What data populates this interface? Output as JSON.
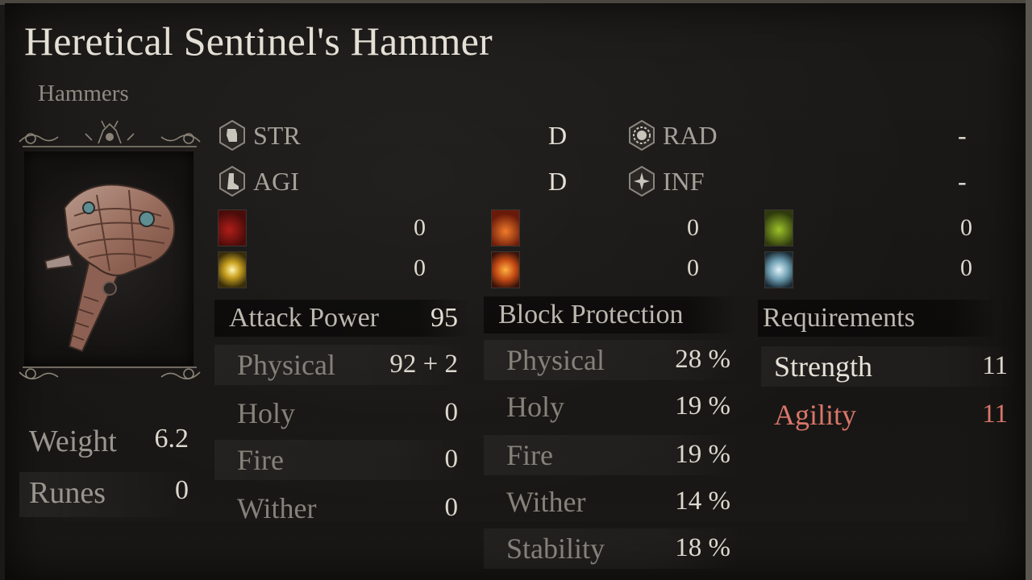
{
  "item": {
    "name": "Heretical Sentinel's Hammer",
    "category": "Hammers"
  },
  "weight": {
    "label": "Weight",
    "value": "6.2"
  },
  "runes": {
    "label": "Runes",
    "value": "0"
  },
  "scaling": [
    {
      "label": "STR",
      "grade": "D",
      "icon": "fist-icon"
    },
    {
      "label": "AGI",
      "grade": "D",
      "icon": "boot-icon"
    },
    {
      "label": "RAD",
      "grade": "-",
      "icon": "sun-icon"
    },
    {
      "label": "INF",
      "grade": "-",
      "icon": "compass-icon"
    }
  ],
  "status_buildup": [
    {
      "icon": "bleed-icon",
      "value": "0",
      "color": "#7a1612"
    },
    {
      "icon": "fire-burst-icon",
      "value": "0",
      "color": "#c2451a"
    },
    {
      "icon": "poison-icon",
      "value": "0",
      "color": "#6c8a1c"
    },
    {
      "icon": "holy-light-icon",
      "value": "0",
      "color": "#e8d048"
    },
    {
      "icon": "explosion-icon",
      "value": "0",
      "color": "#d86a1c"
    },
    {
      "icon": "frost-icon",
      "value": "0",
      "color": "#9ec8d8"
    }
  ],
  "attack_power": {
    "title": "Attack Power",
    "total": "95",
    "rows": [
      {
        "label": "Physical",
        "value": "92 +  2"
      },
      {
        "label": "Holy",
        "value": "0"
      },
      {
        "label": "Fire",
        "value": "0"
      },
      {
        "label": "Wither",
        "value": "0"
      }
    ]
  },
  "block_protection": {
    "title": "Block Protection",
    "rows": [
      {
        "label": "Physical",
        "value": "28 %"
      },
      {
        "label": "Holy",
        "value": "19 %"
      },
      {
        "label": "Fire",
        "value": "19 %"
      },
      {
        "label": "Wither",
        "value": "14 %"
      },
      {
        "label": "Stability",
        "value": "18 %"
      }
    ]
  },
  "requirements": {
    "title": "Requirements",
    "rows": [
      {
        "label": "Strength",
        "value": "11",
        "met": true
      },
      {
        "label": "Agility",
        "value": "11",
        "met": false
      }
    ]
  },
  "colors": {
    "unmet_requirement": "#d9766a",
    "background": "#1b1917"
  }
}
